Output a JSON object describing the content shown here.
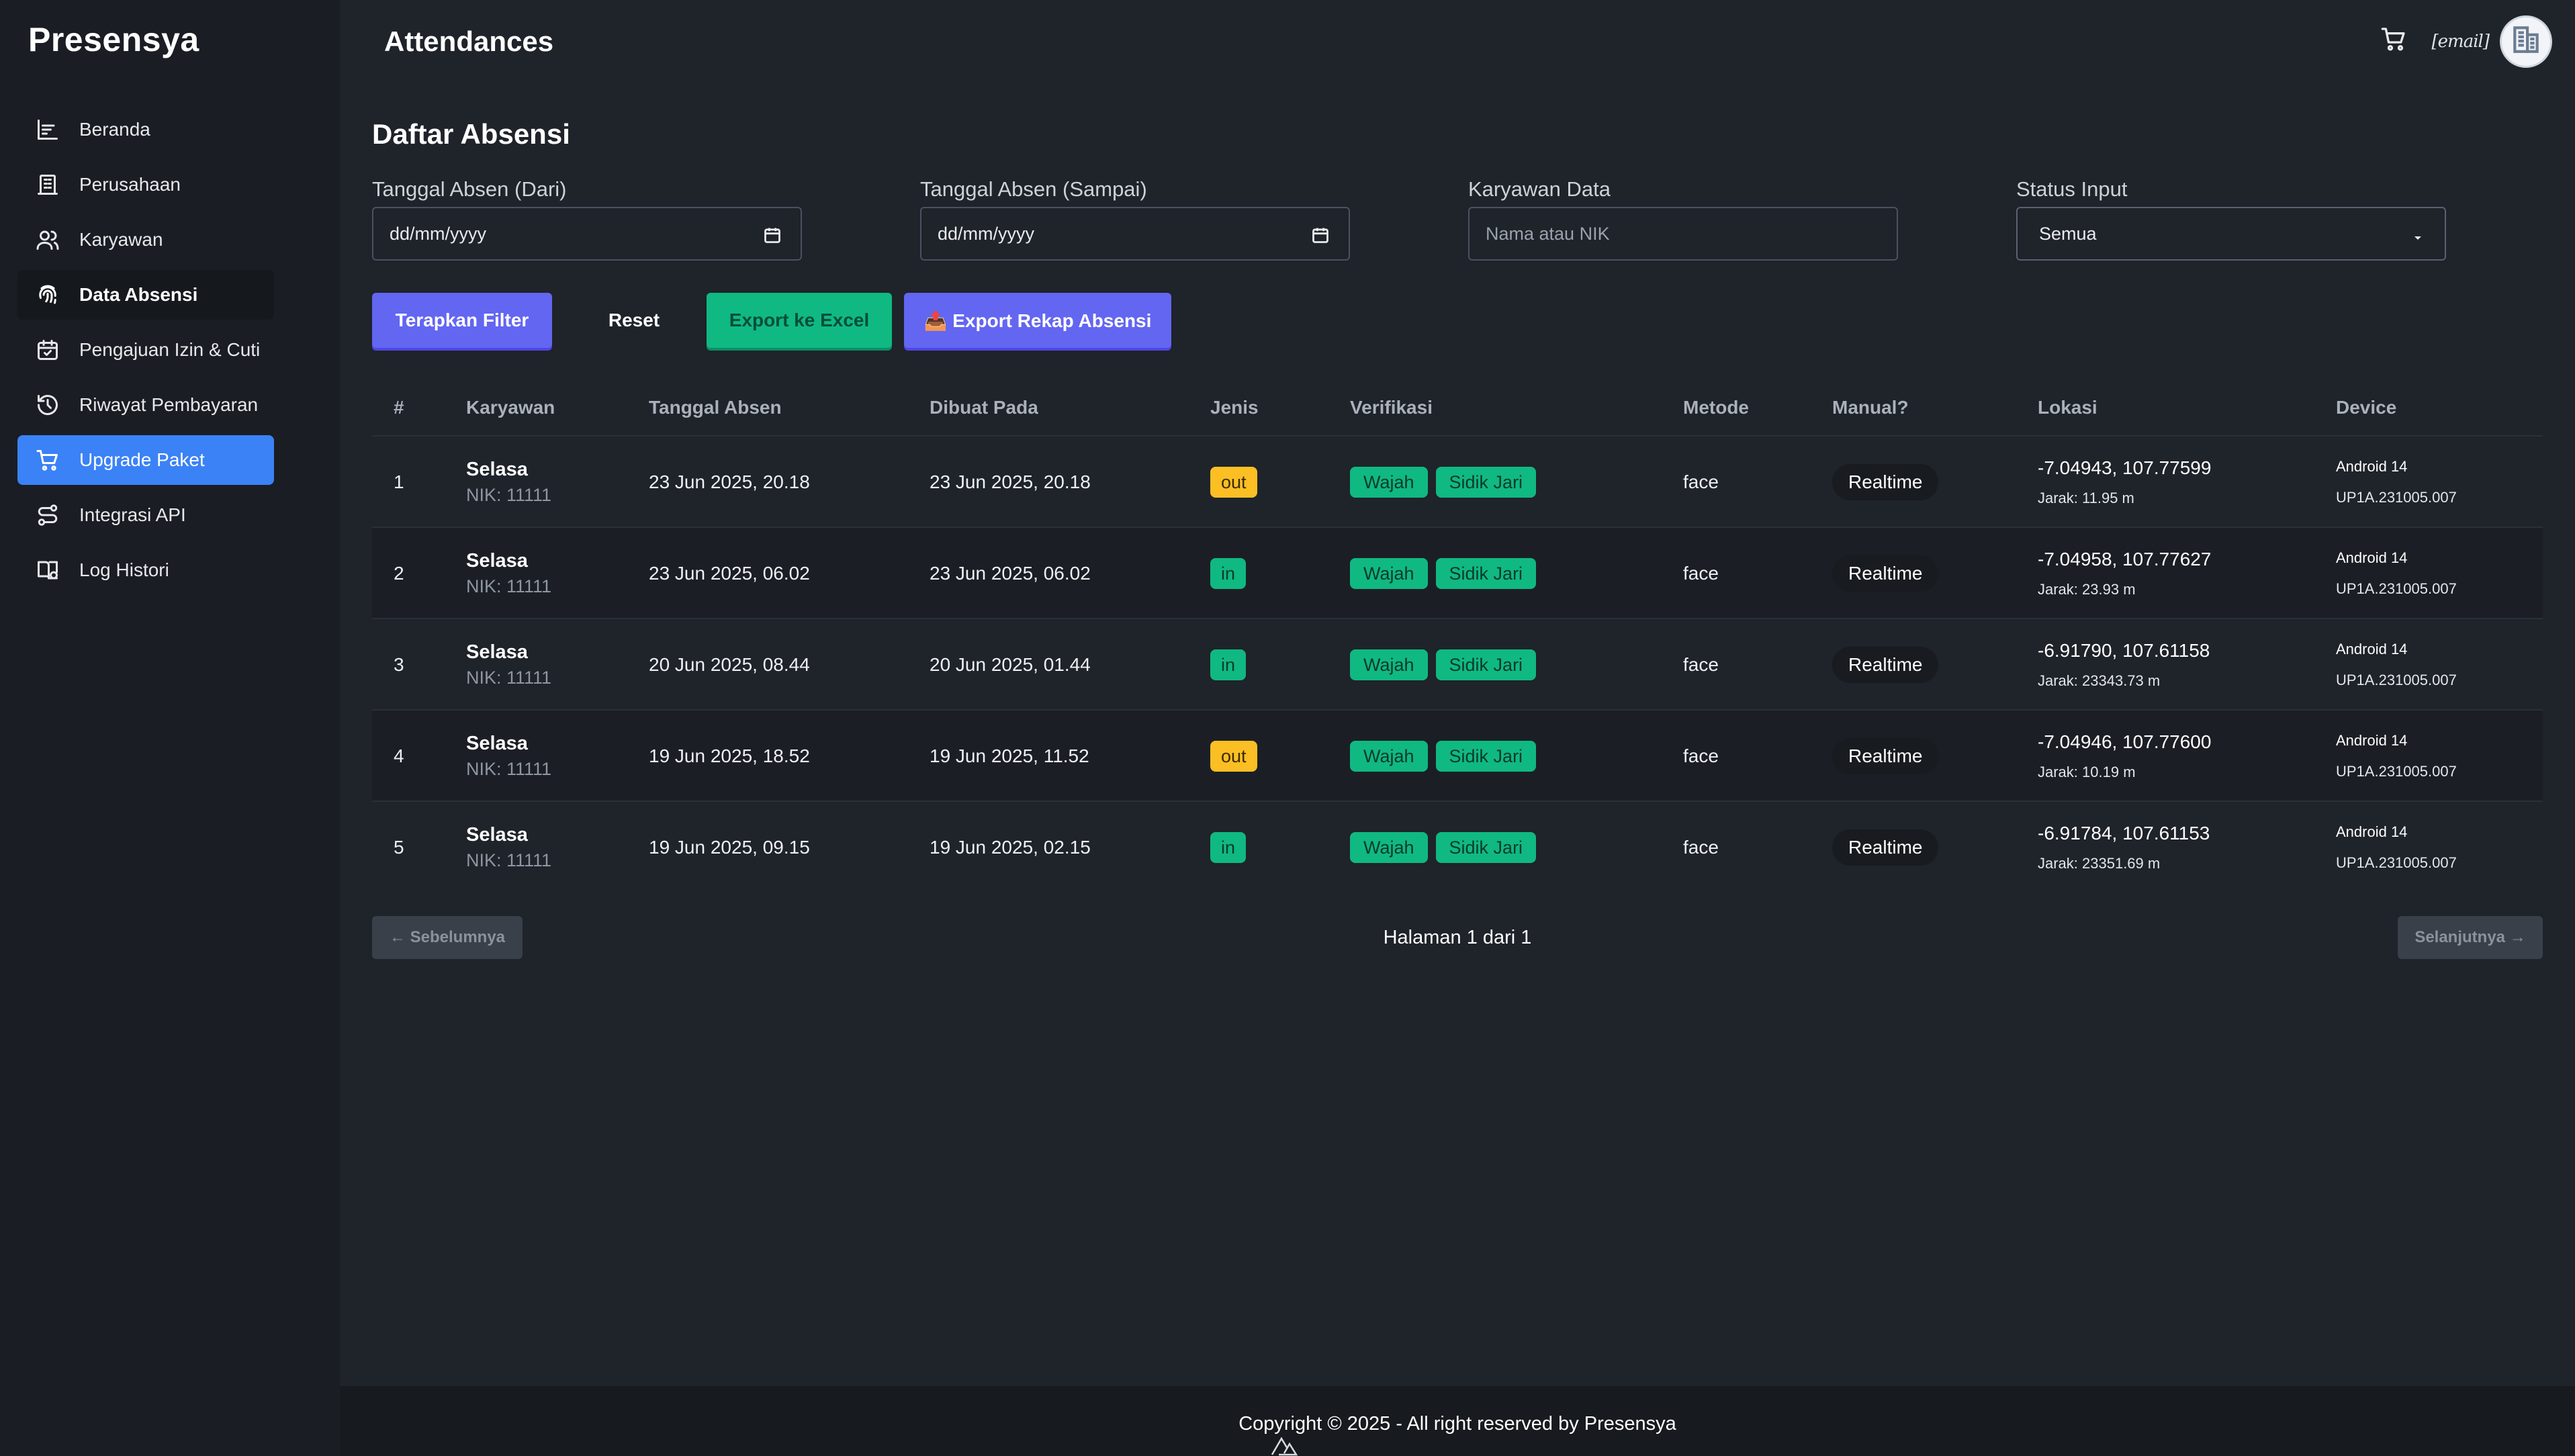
{
  "app": {
    "brand": "Presensya",
    "page_title": "Attendances"
  },
  "header": {
    "user_email": "[email]"
  },
  "sidebar": {
    "items": [
      {
        "label": "Beranda",
        "icon": "chart-icon",
        "state": "active"
      },
      {
        "label": "Perusahaan",
        "icon": "building-icon",
        "state": ""
      },
      {
        "label": "Karyawan",
        "icon": "users-icon",
        "state": ""
      },
      {
        "label": "Data Absensi",
        "icon": "fingerprint-icon",
        "state": "active"
      },
      {
        "label": "Pengajuan Izin & Cuti",
        "icon": "calendar-check-icon",
        "state": ""
      },
      {
        "label": "Riwayat Pembayaran",
        "icon": "history-icon",
        "state": ""
      },
      {
        "label": "Upgrade Paket",
        "icon": "cart-icon",
        "state": "primary"
      },
      {
        "label": "Integrasi API",
        "icon": "route-icon",
        "state": ""
      },
      {
        "label": "Log Histori",
        "icon": "book-icon",
        "state": ""
      }
    ]
  },
  "main": {
    "section_title": "Daftar Absensi",
    "filters": {
      "date_from_label": "Tanggal Absen (Dari)",
      "date_from_value": "dd/mm/yyyy",
      "date_to_label": "Tanggal Absen (Sampai)",
      "date_to_value": "dd/mm/yyyy",
      "employee_label": "Karyawan Data",
      "employee_placeholder": "Nama atau NIK",
      "status_label": "Status Input",
      "status_value": "Semua"
    },
    "buttons": {
      "apply": "Terapkan Filter",
      "reset": "Reset",
      "export_excel": "Export ke Excel",
      "export_recap": "📤 Export Rekap Absensi"
    },
    "table": {
      "columns": [
        "#",
        "Karyawan",
        "Tanggal Absen",
        "Dibuat Pada",
        "Jenis",
        "Verifikasi",
        "Metode",
        "Manual?",
        "Lokasi",
        "Device"
      ],
      "rows": [
        {
          "no": "1",
          "name": "Selasa",
          "nik": "NIK: 11111",
          "tanggal": "23 Jun 2025, 20.18",
          "dibuat": "23 Jun 2025, 20.18",
          "jenis": "out",
          "ver1": "Wajah",
          "ver2": "Sidik Jari",
          "metode": "face",
          "manual": "Realtime",
          "lokasi": "-7.04943, 107.77599",
          "jarak": "Jarak: 11.95 m",
          "device": "Android 14",
          "build": "UP1A.231005.007"
        },
        {
          "no": "2",
          "name": "Selasa",
          "nik": "NIK: 11111",
          "tanggal": "23 Jun 2025, 06.02",
          "dibuat": "23 Jun 2025, 06.02",
          "jenis": "in",
          "ver1": "Wajah",
          "ver2": "Sidik Jari",
          "metode": "face",
          "manual": "Realtime",
          "lokasi": "-7.04958, 107.77627",
          "jarak": "Jarak: 23.93 m",
          "device": "Android 14",
          "build": "UP1A.231005.007"
        },
        {
          "no": "3",
          "name": "Selasa",
          "nik": "NIK: 11111",
          "tanggal": "20 Jun 2025, 08.44",
          "dibuat": "20 Jun 2025, 01.44",
          "jenis": "in",
          "ver1": "Wajah",
          "ver2": "Sidik Jari",
          "metode": "face",
          "manual": "Realtime",
          "lokasi": "-6.91790, 107.61158",
          "jarak": "Jarak: 23343.73 m",
          "device": "Android 14",
          "build": "UP1A.231005.007"
        },
        {
          "no": "4",
          "name": "Selasa",
          "nik": "NIK: 11111",
          "tanggal": "19 Jun 2025, 18.52",
          "dibuat": "19 Jun 2025, 11.52",
          "jenis": "out",
          "ver1": "Wajah",
          "ver2": "Sidik Jari",
          "metode": "face",
          "manual": "Realtime",
          "lokasi": "-7.04946, 107.77600",
          "jarak": "Jarak: 10.19 m",
          "device": "Android 14",
          "build": "UP1A.231005.007"
        },
        {
          "no": "5",
          "name": "Selasa",
          "nik": "NIK: 11111",
          "tanggal": "19 Jun 2025, 09.15",
          "dibuat": "19 Jun 2025, 02.15",
          "jenis": "in",
          "ver1": "Wajah",
          "ver2": "Sidik Jari",
          "metode": "face",
          "manual": "Realtime",
          "lokasi": "-6.91784, 107.61153",
          "jarak": "Jarak: 23351.69 m",
          "device": "Android 14",
          "build": "UP1A.231005.007"
        }
      ]
    },
    "pagination": {
      "prev": "← Sebelumnya",
      "info": "Halaman 1 dari 1",
      "next": "Selanjutnya →"
    }
  },
  "footer": {
    "text": "Copyright © 2025 - All right reserved by Presensya"
  },
  "colors": {
    "accent_blue": "#3b82f6",
    "button_purple": "#6366f1",
    "button_green": "#10b981",
    "badge_out": "#fbbf24",
    "badge_in": "#10b981"
  }
}
